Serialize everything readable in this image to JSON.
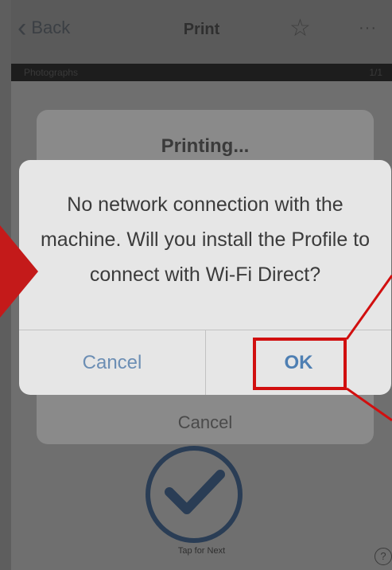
{
  "navbar": {
    "back_label": "Back",
    "back_icon": "chevron-left",
    "title": "Print",
    "star_icon": "☆",
    "more_icon": "···"
  },
  "subbar": {
    "left_text": "Photographs",
    "right_text": "1/1"
  },
  "printing_sheet": {
    "title": "Printing...",
    "cancel_label": "Cancel"
  },
  "alert": {
    "message": "No network connection with the machine. Will you install the Profile to connect with Wi-Fi Direct?",
    "cancel_label": "Cancel",
    "ok_label": "OK"
  },
  "bottom": {
    "tap_label": "Tap for Next",
    "help_icon": "?"
  },
  "colors": {
    "annotation_red": "#d10f0f",
    "button_blue": "#4e7fb3",
    "check_navy": "#2a3d55"
  }
}
